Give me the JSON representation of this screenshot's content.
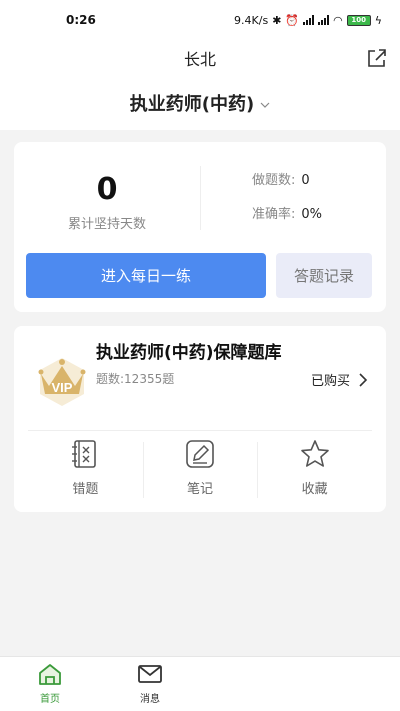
{
  "status_bar": {
    "time": "0:26",
    "network_speed": "9.4K/s",
    "battery": "100"
  },
  "nav": {
    "title": "长北"
  },
  "subject": {
    "title": "执业药师(中药)"
  },
  "stats": {
    "days_value": "0",
    "days_label": "累计坚持天数",
    "questions_label": "做题数:",
    "questions_value": "0",
    "accuracy_label": "准确率:",
    "accuracy_value": "0%"
  },
  "buttons": {
    "daily_practice": "进入每日一练",
    "answer_record": "答题记录"
  },
  "bank": {
    "title": "执业药师(中药)保障题库",
    "count": "题数:12355题",
    "status": "已购买",
    "vip_text": "VIP"
  },
  "tools": [
    {
      "label": "错题",
      "icon": "wrong-questions-icon"
    },
    {
      "label": "笔记",
      "icon": "notes-icon"
    },
    {
      "label": "收藏",
      "icon": "star-icon"
    }
  ],
  "tabs": [
    {
      "label": "首页",
      "icon": "home-icon",
      "active": true
    },
    {
      "label": "消息",
      "icon": "mail-icon",
      "active": false
    }
  ],
  "colors": {
    "primary": "#4d8af0",
    "secondary_button": "#eaecf8",
    "active_tab": "#3a9a3a",
    "vip_gold": "#d9b46a"
  }
}
